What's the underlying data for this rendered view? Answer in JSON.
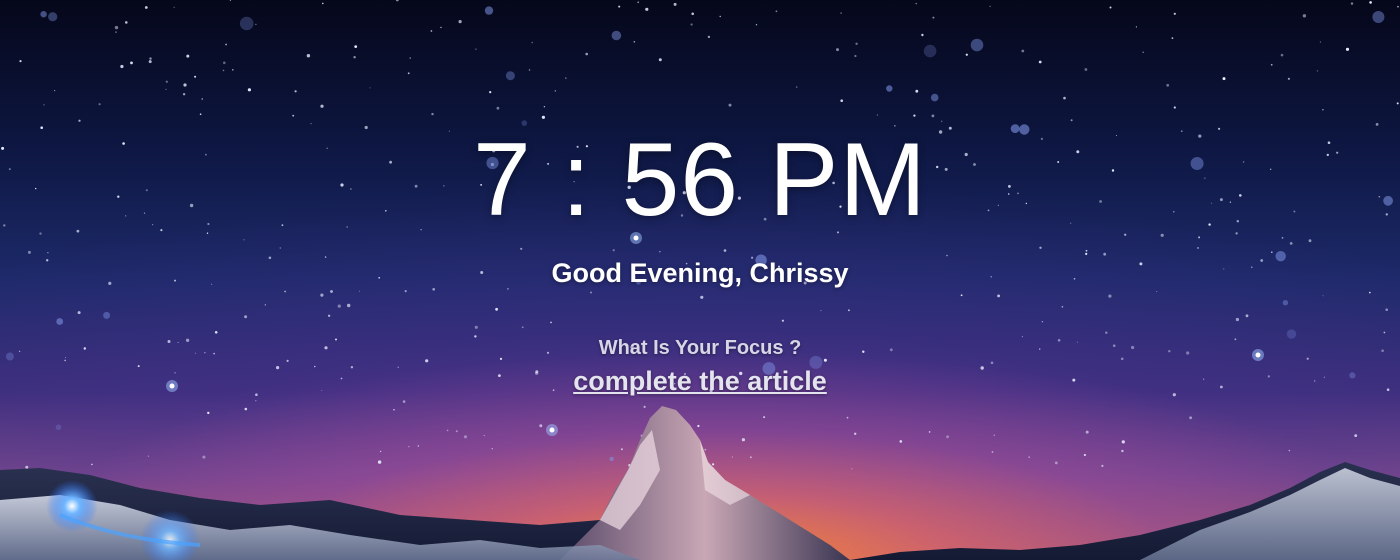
{
  "clock": {
    "time": "7 : 56 PM"
  },
  "greeting": {
    "text": "Good Evening, Chrissy"
  },
  "focus": {
    "question": "What Is Your Focus ?",
    "task": "complete the article"
  },
  "colors": {
    "text_primary": "#ffffff",
    "text_secondary": "#d6d6e6",
    "sky_top": "#05071a",
    "horizon_glow": "#ff8c28"
  },
  "background": {
    "scene": "starry night sky over snowy mountain peak"
  }
}
